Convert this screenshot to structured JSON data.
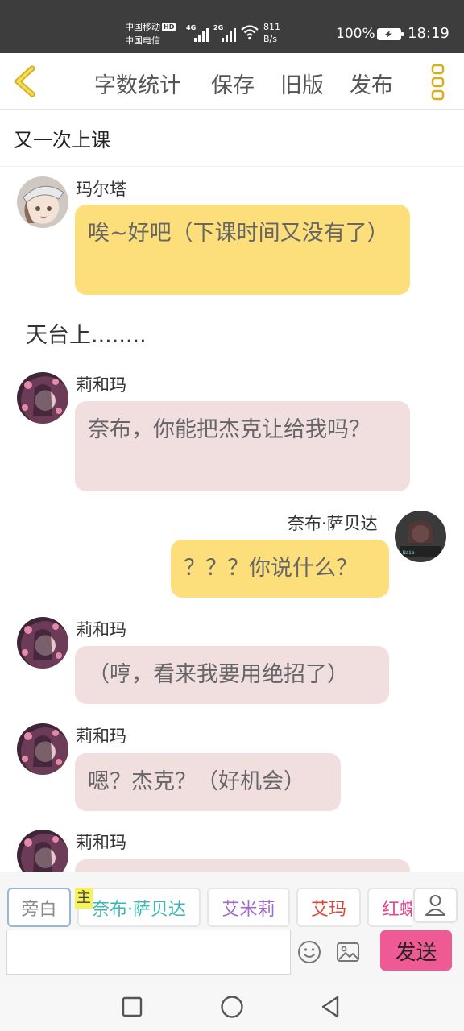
{
  "status_bar": {
    "carrier_1": "中国移动",
    "carrier_1_badge": "HD",
    "carrier_2": "中国电信",
    "signal_1_tag": "4G",
    "signal_2_tag": "2G",
    "net_speed_value": "811",
    "net_speed_unit": "B/s",
    "battery_percent": "100%",
    "time": "18:19"
  },
  "toolbar": {
    "word_count": "字数统计",
    "save": "保存",
    "old_version": "旧版",
    "publish": "发布"
  },
  "document": {
    "title": "又一次上课"
  },
  "messages": [
    {
      "speaker": "玛尔塔",
      "text": "唉~好吧（下课时间又没有了）",
      "side": "left",
      "color": "#fcdf7b"
    },
    {
      "narration": "天台上........"
    },
    {
      "speaker": "莉和玛",
      "text": "奈布，你能把杰克让给我吗？",
      "side": "left",
      "color": "#f1dfe0"
    },
    {
      "speaker": "奈布·萨贝达",
      "text": "？？？你说什么？",
      "side": "right",
      "color": "#fcdf7b"
    },
    {
      "speaker": "莉和玛",
      "text": "（哼，看来我要用绝招了）",
      "side": "left",
      "color": "#f1dfe0"
    },
    {
      "speaker": "莉和玛",
      "text": "嗯？杰克？（好机会）",
      "side": "left",
      "color": "#f1dfe0"
    },
    {
      "speaker": "莉和玛",
      "text": "",
      "side": "left",
      "color": "#f1dfe0"
    }
  ],
  "roles": {
    "host_tag": "主",
    "items": [
      {
        "label": "旁白",
        "color": "#888888"
      },
      {
        "label": "奈布·萨贝达",
        "color": "#3bb8b5"
      },
      {
        "label": "艾米莉",
        "color": "#a06ac8"
      },
      {
        "label": "艾玛",
        "color": "#e0433a"
      },
      {
        "label": "红蝶",
        "color": "#e04a8c"
      }
    ]
  },
  "composer": {
    "placeholder": "",
    "send": "发送"
  },
  "icons": {
    "back": "chevron-left-icon",
    "more": "more-vertical-icon",
    "emoji": "smiley-icon",
    "image": "image-icon",
    "add_role": "person-icon",
    "nav_recent": "square-icon",
    "nav_home": "circle-icon",
    "nav_back": "triangle-back-icon"
  },
  "colors": {
    "accent": "#f2c200",
    "send": "#f05a94",
    "bubble_yellow": "#fcdf7b",
    "bubble_pink": "#f1dfe0"
  }
}
